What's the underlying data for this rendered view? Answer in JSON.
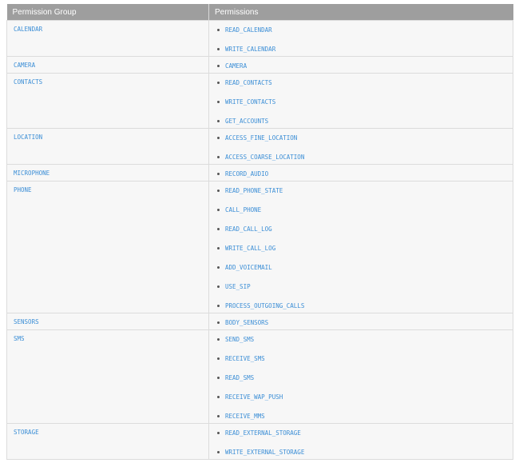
{
  "table": {
    "headers": [
      "Permission Group",
      "Permissions"
    ],
    "rows": [
      {
        "group": "CALENDAR",
        "permissions": [
          "READ_CALENDAR",
          "WRITE_CALENDAR"
        ]
      },
      {
        "group": "CAMERA",
        "permissions": [
          "CAMERA"
        ]
      },
      {
        "group": "CONTACTS",
        "permissions": [
          "READ_CONTACTS",
          "WRITE_CONTACTS",
          "GET_ACCOUNTS"
        ]
      },
      {
        "group": "LOCATION",
        "permissions": [
          "ACCESS_FINE_LOCATION",
          "ACCESS_COARSE_LOCATION"
        ]
      },
      {
        "group": "MICROPHONE",
        "permissions": [
          "RECORD_AUDIO"
        ]
      },
      {
        "group": "PHONE",
        "permissions": [
          "READ_PHONE_STATE",
          "CALL_PHONE",
          "READ_CALL_LOG",
          "WRITE_CALL_LOG",
          "ADD_VOICEMAIL",
          "USE_SIP",
          "PROCESS_OUTGOING_CALLS"
        ]
      },
      {
        "group": "SENSORS",
        "permissions": [
          "BODY_SENSORS"
        ]
      },
      {
        "group": "SMS",
        "permissions": [
          "SEND_SMS",
          "RECEIVE_SMS",
          "READ_SMS",
          "RECEIVE_WAP_PUSH",
          "RECEIVE_MMS"
        ]
      },
      {
        "group": "STORAGE",
        "permissions": [
          "READ_EXTERNAL_STORAGE",
          "WRITE_EXTERNAL_STORAGE"
        ]
      }
    ]
  }
}
